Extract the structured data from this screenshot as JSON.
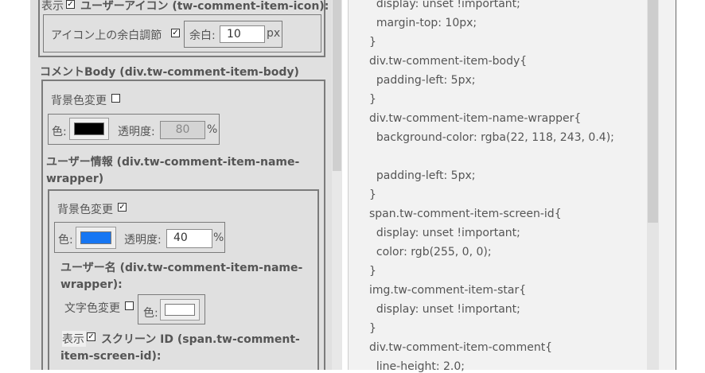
{
  "left": {
    "icon_section": {
      "show_label": "表示",
      "title": "ユーザーアイコン (tw-comment-item-icon):",
      "margin_adjust_label": "アイコン上の余白調節",
      "margin_label": "余白:",
      "margin_value": "10",
      "margin_unit": "px"
    },
    "body_section": {
      "title": "コメントBody (div.tw-comment-item-body)",
      "bg_change_label": "背景色変更",
      "color_label": "色:",
      "color_value": "#000000",
      "opacity_label": "透明度:",
      "opacity_value": "80",
      "percent": "%"
    },
    "user_info_section": {
      "title_line1": "ユーザー情報 (div.tw-comment-item-name-",
      "title_line2": "wrapper)",
      "bg_change_label": "背景色変更",
      "color_label": "色:",
      "color_value": "#1676f3",
      "opacity_label": "透明度:",
      "opacity_value": "40",
      "percent": "%"
    },
    "user_name_section": {
      "title_line1": "ユーザー名 (div.tw-comment-item-name-",
      "title_line2": "wrapper):",
      "text_color_change_label": "文字色変更",
      "color_label": "色:",
      "color_value": "#ffffff"
    },
    "screen_id_section": {
      "show_label": "表示",
      "title_line1": "スクリーン ID (span.tw-comment-",
      "title_line2": "item-screen-id):"
    }
  },
  "code_lines": [
    "  display: unset !important;",
    "  margin-top: 10px;",
    "}",
    "div.tw-comment-item-body{",
    "  padding-left: 5px;",
    "}",
    "div.tw-comment-item-name-wrapper{",
    "  background-color: rgba(22, 118, 243, 0.4);",
    "",
    "  padding-left: 5px;",
    "}",
    "span.tw-comment-item-screen-id{",
    "  display: unset !important;",
    "  color: rgb(255, 0, 0);",
    "}",
    "img.tw-comment-item-star{",
    "  display: unset !important;",
    "}",
    "div.tw-comment-item-comment{",
    "  line-height: 2.0;"
  ]
}
